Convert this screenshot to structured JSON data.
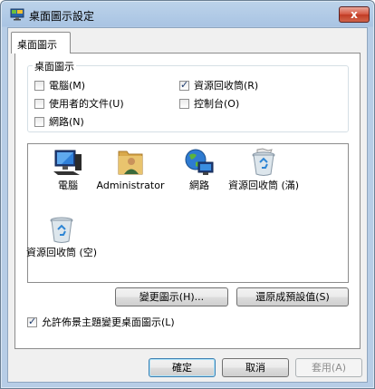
{
  "window": {
    "title": "桌面圖示設定",
    "close_label": "x"
  },
  "tabs": [
    {
      "label": "桌面圖示"
    }
  ],
  "group": {
    "label": "桌面圖示",
    "checkboxes": [
      {
        "label": "電腦(M)",
        "checked": false
      },
      {
        "label": "使用者的文件(U)",
        "checked": false
      },
      {
        "label": "網路(N)",
        "checked": false
      },
      {
        "label": "資源回收筒(R)",
        "checked": true
      },
      {
        "label": "控制台(O)",
        "checked": false
      }
    ]
  },
  "icons": [
    {
      "label": "電腦",
      "icon": "computer-icon"
    },
    {
      "label": "Administrator",
      "icon": "user-folder-icon"
    },
    {
      "label": "網路",
      "icon": "network-icon"
    },
    {
      "label": "資源回收筒 (滿)",
      "icon": "recycle-bin-full-icon"
    },
    {
      "label": "資源回收筒 (空)",
      "icon": "recycle-bin-empty-icon"
    }
  ],
  "buttons": {
    "change_icon": "變更圖示(H)...",
    "restore_default": "還原成預設值(S)",
    "ok": "確定",
    "cancel": "取消",
    "apply": "套用(A)"
  },
  "theme_checkbox": {
    "label": "允許佈景主題變更桌面圖示(L)",
    "checked": true
  }
}
